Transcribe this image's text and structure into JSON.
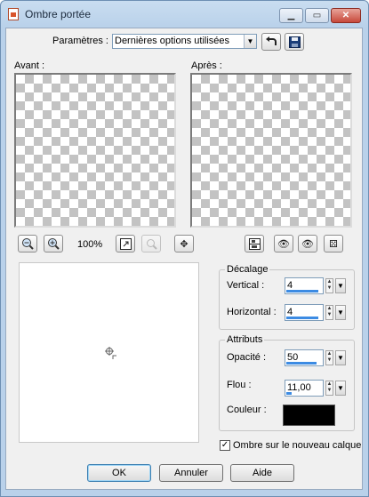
{
  "window": {
    "title": "Ombre portée"
  },
  "presets": {
    "label": "Paramètres :",
    "value": "Dernières options utilisées"
  },
  "preview": {
    "before_label": "Avant :",
    "after_label": "Après :",
    "zoom": "100%"
  },
  "offset": {
    "title": "Décalage",
    "vertical_label": "Vertical :",
    "vertical_value": "4",
    "horizontal_label": "Horizontal :",
    "horizontal_value": "4"
  },
  "attributes": {
    "title": "Attributs",
    "opacity_label": "Opacité :",
    "opacity_value": "50",
    "blur_label": "Flou :",
    "blur_value": "11,00",
    "color_label": "Couleur :",
    "color": "#000000"
  },
  "new_layer": {
    "label": "Ombre sur le nouveau calque",
    "checked": true
  },
  "buttons": {
    "ok": "OK",
    "cancel": "Annuler",
    "help": "Aide"
  }
}
